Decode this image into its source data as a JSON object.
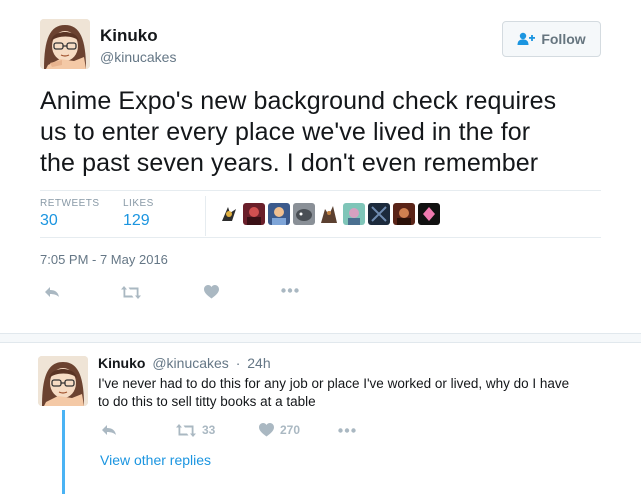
{
  "tweet": {
    "author_name": "Kinuko",
    "author_handle": "@kinucakes",
    "follow_label": "Follow",
    "text_lines": [
      "Anime Expo's new background check requires",
      "us to enter every place we've lived in the for",
      "the past seven years. I don't even remember"
    ],
    "stats": {
      "retweets_label": "RETWEETS",
      "retweets_value": "30",
      "likes_label": "LIKES",
      "likes_value": "129"
    },
    "timestamp": "7:05 PM - 7 May 2016",
    "actions": {
      "reply_icon": "reply-icon",
      "retweet_icon": "retweet-icon",
      "like_icon": "heart-icon",
      "more_icon": "more-icon"
    }
  },
  "reply": {
    "author_name": "Kinuko",
    "author_handle": "@kinucakes",
    "separator": "·",
    "time": "24h",
    "text_lines": [
      "I've never had to do this for any job or place I've worked or lived, why do I have",
      "to do this to sell titty books at a table"
    ],
    "retweet_count": "33",
    "like_count": "270",
    "view_other_replies": "View other replies"
  },
  "colors": {
    "accent": "#1b95e0",
    "muted": "#657786",
    "icon": "#aab8c2",
    "thread_line": "#4ab3f4"
  }
}
